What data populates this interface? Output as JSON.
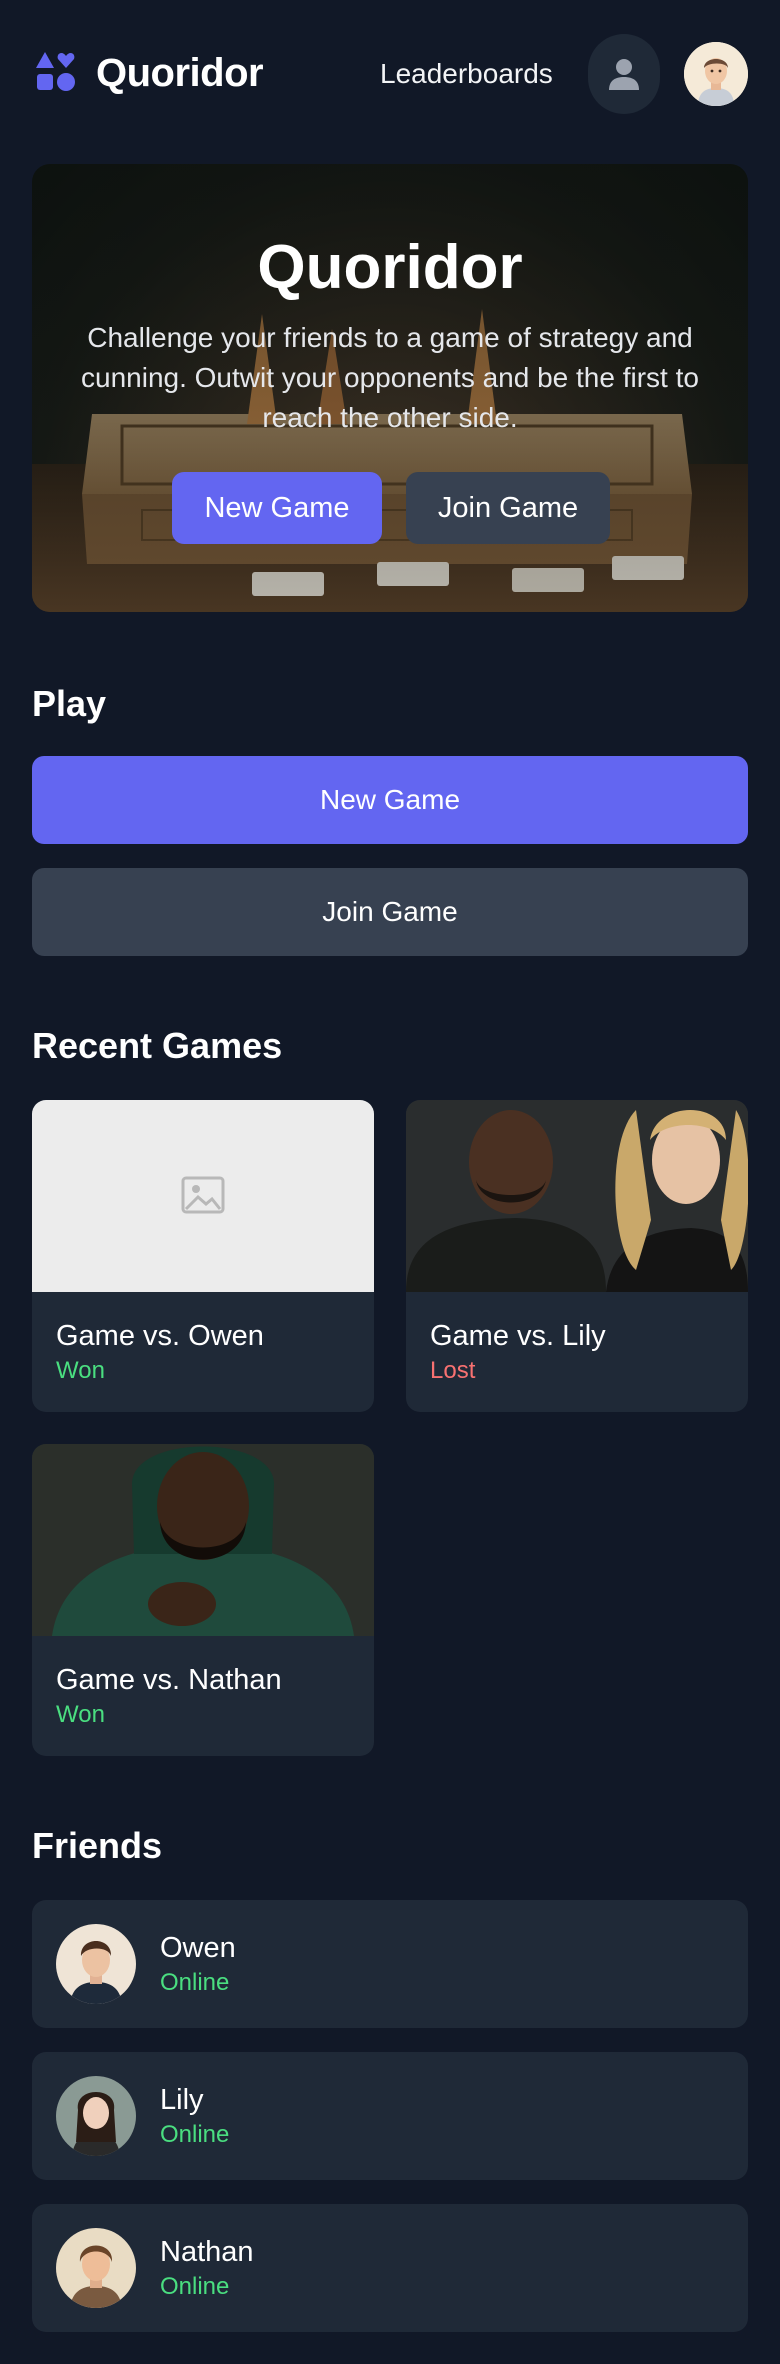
{
  "header": {
    "brand": "Quoridor",
    "nav_link": "Leaderboards",
    "profile_icon": "person-icon",
    "logo_icon": "shapes-logo-icon"
  },
  "hero": {
    "title": "Quoridor",
    "subtitle": "Challenge your friends to a game of strategy and cunning. Outwit your opponents and be the first to reach the other side.",
    "new_game_label": "New Game",
    "join_game_label": "Join Game"
  },
  "play": {
    "title": "Play",
    "new_game_label": "New Game",
    "join_game_label": "Join Game"
  },
  "recent": {
    "title": "Recent Games",
    "games": [
      {
        "title": "Game vs. Owen",
        "result": "Won"
      },
      {
        "title": "Game vs. Lily",
        "result": "Lost"
      },
      {
        "title": "Game vs. Nathan",
        "result": "Won"
      }
    ]
  },
  "friends": {
    "title": "Friends",
    "items": [
      {
        "name": "Owen",
        "status": "Online"
      },
      {
        "name": "Lily",
        "status": "Online"
      },
      {
        "name": "Nathan",
        "status": "Online"
      }
    ]
  },
  "colors": {
    "background": "#111827",
    "card": "#1f2937",
    "accent": "#6366f1",
    "secondary_button": "#374151",
    "won": "#4ade80",
    "lost": "#f87171",
    "online": "#4ade80"
  }
}
